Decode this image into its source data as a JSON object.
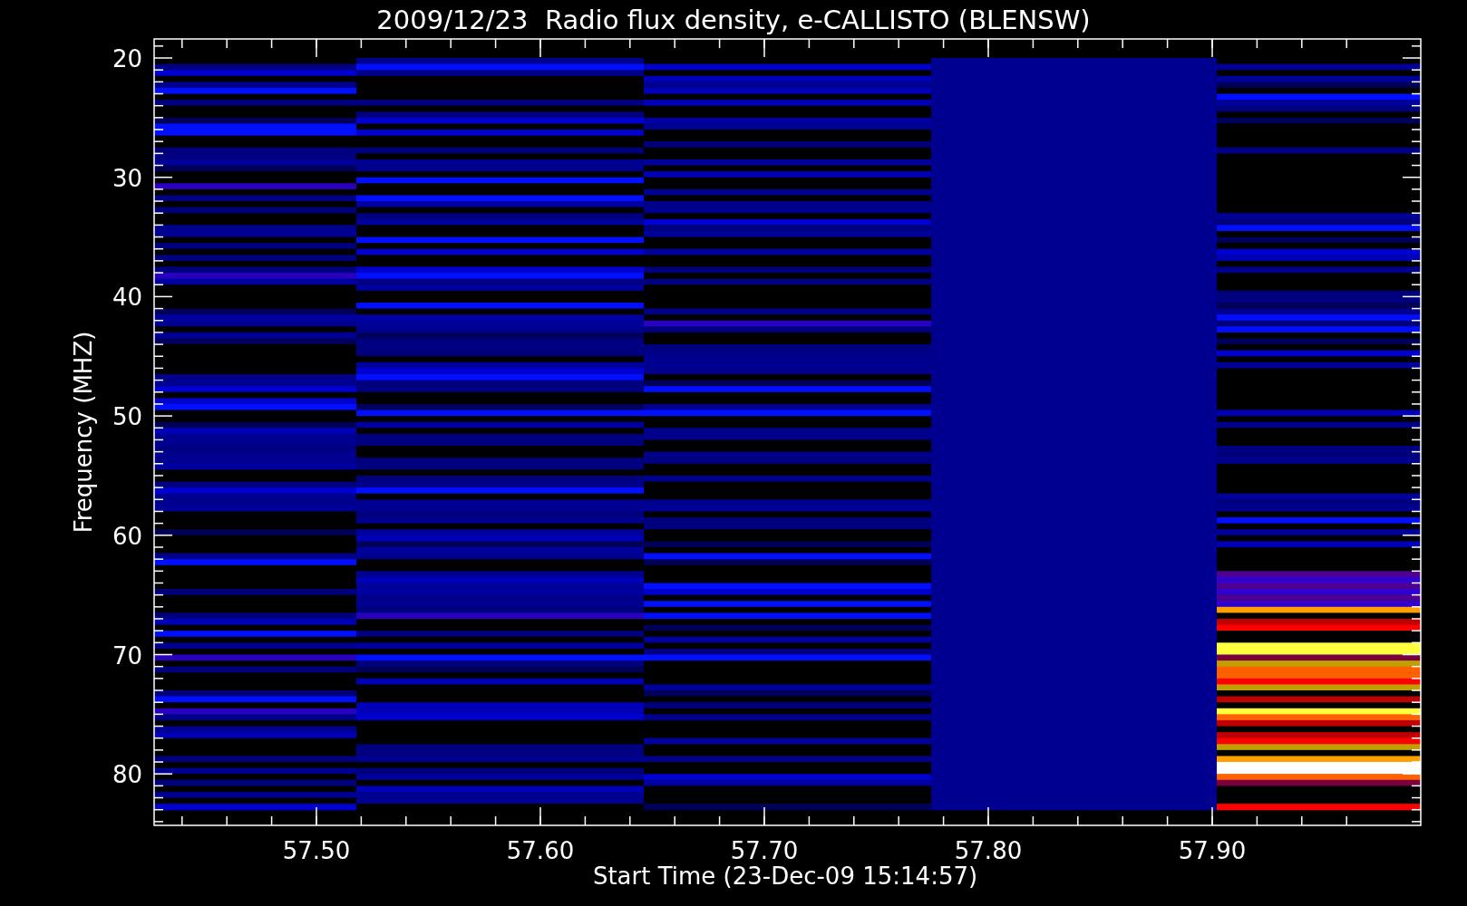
{
  "title": "2009/12/23  Radio flux density, e-CALLISTO (BLENSW)",
  "xlabel": "Start Time (23-Dec-09 15:14:57)",
  "ylabel": "Frequency (MHZ)",
  "xticks": [
    "57.50",
    "57.60",
    "57.70",
    "57.80",
    "57.90"
  ],
  "yticks": [
    "20",
    "30",
    "40",
    "50",
    "60",
    "70",
    "80"
  ]
}
